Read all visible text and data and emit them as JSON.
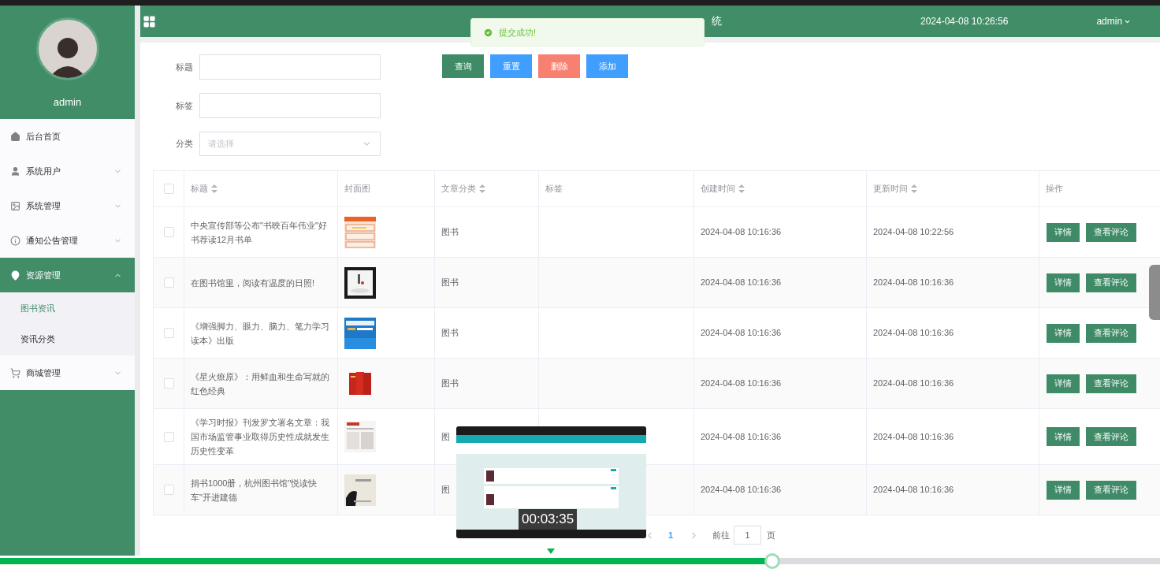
{
  "header": {
    "title": "统",
    "datetime": "2024-04-08 10:26:56",
    "user": "admin"
  },
  "toast": {
    "message": "提交成功!"
  },
  "sidebar": {
    "username": "admin",
    "items": [
      {
        "label": "后台首页",
        "selected": false
      },
      {
        "label": "系统用户",
        "selected": false,
        "expanded": false
      },
      {
        "label": "系统管理",
        "selected": false,
        "expanded": false
      },
      {
        "label": "通知公告管理",
        "selected": false,
        "expanded": false
      },
      {
        "label": "资源管理",
        "selected": true,
        "expanded": true,
        "children": [
          {
            "label": "图书资讯",
            "selected": true
          },
          {
            "label": "资讯分类",
            "selected": false
          }
        ]
      },
      {
        "label": "商城管理",
        "selected": false,
        "expanded": false
      }
    ]
  },
  "filters": [
    {
      "label": "标题",
      "kind": "text"
    },
    {
      "label": "标签",
      "kind": "text"
    },
    {
      "label": "分类",
      "kind": "select",
      "placeholder": "请选择"
    }
  ],
  "actions": [
    {
      "label": "查询",
      "color": "#3f8b67"
    },
    {
      "label": "重置",
      "color": "#409eff"
    },
    {
      "label": "删除",
      "color": "#f88071"
    },
    {
      "label": "添加",
      "color": "#409eff"
    }
  ],
  "table": {
    "all_checked": false,
    "columns": [
      {
        "label": "标题",
        "sortable": true
      },
      {
        "label": "封面图",
        "sortable": false
      },
      {
        "label": "文章分类",
        "sortable": true
      },
      {
        "label": "标签",
        "sortable": false
      },
      {
        "label": "创建时间",
        "sortable": true
      },
      {
        "label": "更新时间",
        "sortable": true
      },
      {
        "label": "操作",
        "sortable": false
      }
    ],
    "rows": [
      {
        "checked": false,
        "title": "中央宣传部等公布\"书映百年伟业\"好书荐读12月书单",
        "category": "图书",
        "created": "2024-04-08 10:16:36",
        "updated": "2024-04-08 10:22:56",
        "actions": [
          "详情",
          "查看评论"
        ]
      },
      {
        "checked": false,
        "title": "在图书馆里，阅读有温度的日照!",
        "category": "图书",
        "created": "2024-04-08 10:16:36",
        "updated": "2024-04-08 10:16:36",
        "actions": [
          "详情",
          "查看评论"
        ]
      },
      {
        "checked": false,
        "title": "《增强脚力、眼力、脑力、笔力学习读本》出版",
        "category": "图书",
        "created": "2024-04-08 10:16:36",
        "updated": "2024-04-08 10:16:36",
        "actions": [
          "详情",
          "查看评论"
        ]
      },
      {
        "checked": false,
        "title": "《星火燎原》：用鲜血和生命写就的红色经典",
        "category": "图书",
        "created": "2024-04-08 10:16:36",
        "updated": "2024-04-08 10:16:36",
        "actions": [
          "详情",
          "查看评论"
        ]
      },
      {
        "checked": false,
        "title": "《学习时报》刊发罗文署名文章：我国市场监管事业取得历史性成就发生历史性变革",
        "category": "图",
        "created": "2024-04-08 10:16:36",
        "updated": "2024-04-08 10:16:36",
        "actions": [
          "详情",
          "查看评论"
        ]
      },
      {
        "checked": false,
        "title": "捐书1000册，杭州图书馆\"悦读快车\"开进建德",
        "category": "图",
        "created": "2024-04-08 10:16:36",
        "updated": "2024-04-08 10:16:36",
        "actions": [
          "详情",
          "查看评论"
        ]
      }
    ]
  },
  "pagination": {
    "current_page": "1",
    "goto_label": "前往",
    "goto_value": "1",
    "page_suffix": "页"
  },
  "video": {
    "preview_time": "00:03:35",
    "level": 0.666
  }
}
